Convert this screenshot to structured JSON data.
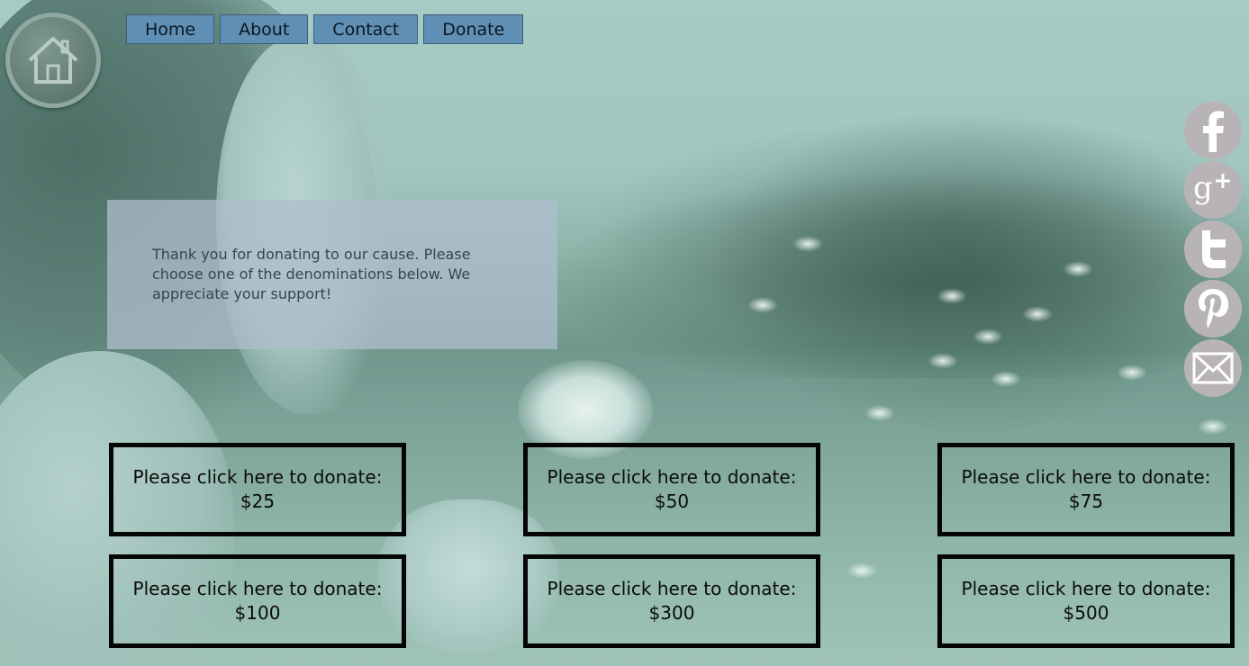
{
  "nav": {
    "home_label": "Home",
    "about_label": "About",
    "contact_label": "Contact",
    "donate_label": "Donate"
  },
  "message": {
    "text": "Thank you for donating to our cause. Please choose one of the denominations below. We appreciate your support!"
  },
  "donations": [
    {
      "prompt": "Please click here to donate:",
      "amount": "$25"
    },
    {
      "prompt": "Please click here to donate:",
      "amount": "$50"
    },
    {
      "prompt": "Please click here to donate:",
      "amount": "$75"
    },
    {
      "prompt": "Please click here to donate:",
      "amount": "$100"
    },
    {
      "prompt": "Please click here to donate:",
      "amount": "$300"
    },
    {
      "prompt": "Please click here to donate:",
      "amount": "$500"
    }
  ],
  "social": [
    "facebook-icon",
    "google-plus-icon",
    "twitter-icon",
    "pinterest-icon",
    "email-icon"
  ],
  "colors": {
    "nav_bg": "#5f8fb5",
    "social_bg": "#b8b3b7",
    "box_border": "#050505"
  }
}
